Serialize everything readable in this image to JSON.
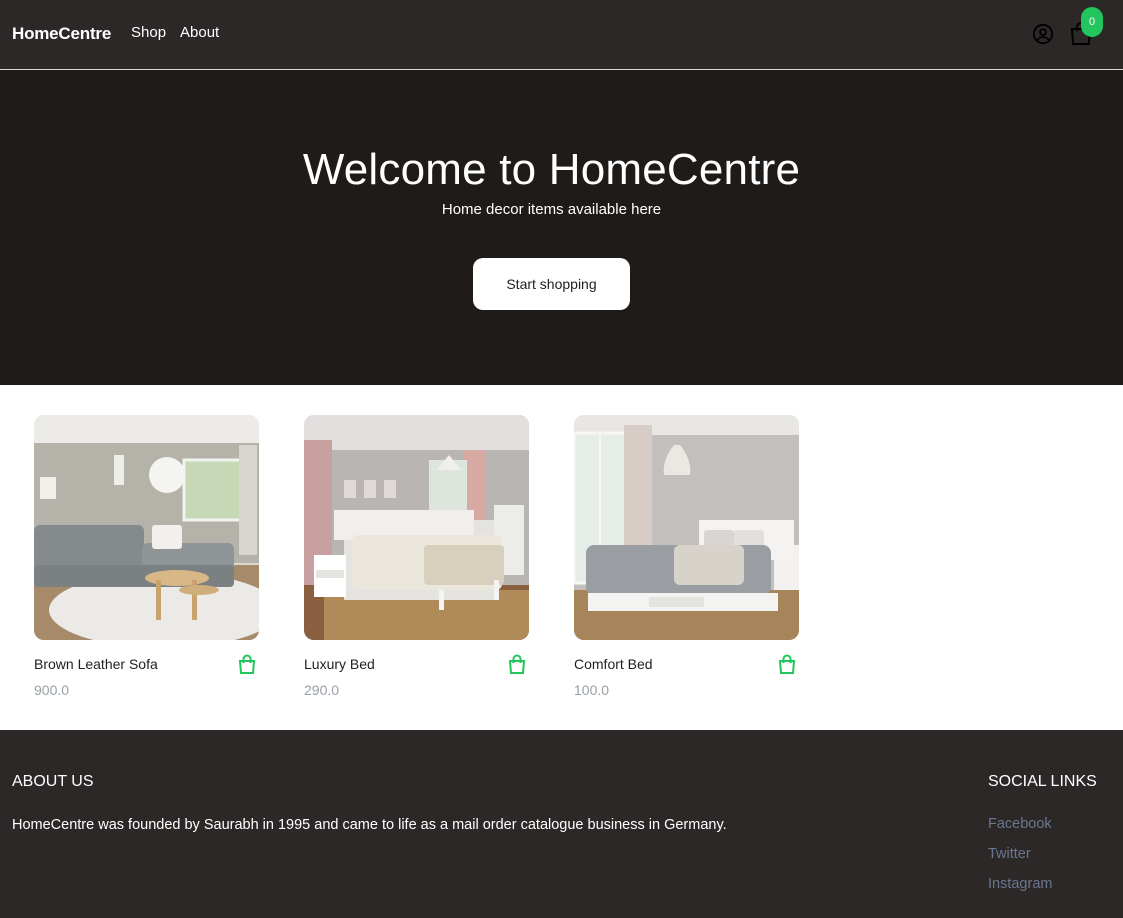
{
  "header": {
    "brand": "HomeCentre",
    "nav": [
      {
        "label": "Shop"
      },
      {
        "label": "About"
      }
    ],
    "user_icon": "user-circle-icon",
    "cart_icon": "shopping-bag-icon",
    "cart_count": "0"
  },
  "hero": {
    "title": "Welcome to HomeCentre",
    "subtitle": "Home decor items available here",
    "button_label": "Start shopping"
  },
  "products": [
    {
      "name": "Brown Leather Sofa",
      "price": "900.0",
      "image_icon": "sofa-room-photo"
    },
    {
      "name": "Luxury Bed",
      "price": "290.0",
      "image_icon": "bedroom-photo"
    },
    {
      "name": "Comfort Bed",
      "price": "100.0",
      "image_icon": "bedroom-photo"
    }
  ],
  "footer": {
    "about_title": "ABOUT US",
    "about_text": "HomeCentre was founded by Saurabh in 1995 and came to life as a mail order catalogue business in Germany.",
    "social_title": "SOCIAL LINKS",
    "social_links": [
      "Facebook",
      "Twitter",
      "Instagram"
    ]
  },
  "colors": {
    "nav_bg": "#2b2827",
    "hero_bg": "#1f1b19",
    "accent": "#22c55e",
    "link": "#6b7690"
  }
}
